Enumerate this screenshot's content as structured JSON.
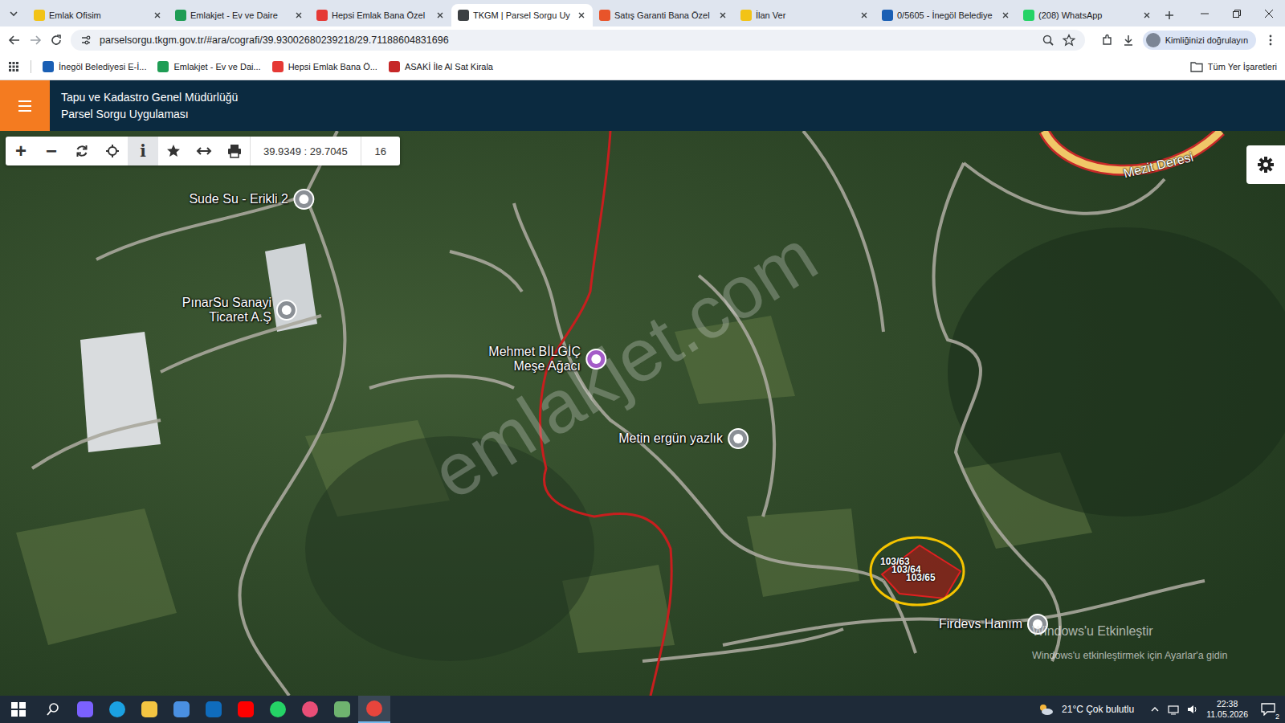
{
  "browser": {
    "tabs": [
      {
        "label": "Emlak Ofisim",
        "selected": false,
        "color": "#f2c316"
      },
      {
        "label": "Emlakjet - Ev ve Daire",
        "selected": false,
        "color": "#1f9d55"
      },
      {
        "label": "Hepsi Emlak Bana Özel",
        "selected": false,
        "color": "#e53935"
      },
      {
        "label": "TKGM | Parsel Sorgu Uy",
        "selected": true,
        "color": "#3c4043"
      },
      {
        "label": "Satış Garanti Bana Özel",
        "selected": false,
        "color": "#e8542a"
      },
      {
        "label": "İlan Ver",
        "selected": false,
        "color": "#f2c316"
      },
      {
        "label": "0/5605 - İnegöl Belediye",
        "selected": false,
        "color": "#1a5fb4"
      },
      {
        "label": "(208) WhatsApp",
        "selected": false,
        "color": "#25d366"
      }
    ],
    "address": {
      "url": "parselsorgu.tkgm.gov.tr/#ara/cografi/39.93002680239218/29.71188604831696",
      "profile": "Kimliğinizi doğrulayın"
    },
    "bookmarks": [
      {
        "label": "İnegöl Belediyesi E-İ...",
        "color": "#1a5fb4"
      },
      {
        "label": "Emlakjet - Ev ve Dai...",
        "color": "#1f9d55"
      },
      {
        "label": "Hepsi Emlak Bana Ö...",
        "color": "#e53935"
      },
      {
        "label": "ASAKİ İle Al Sat Kirala",
        "color": "#c62828"
      }
    ],
    "all_bookmarks": "Tüm Yer İşaretleri"
  },
  "app": {
    "title_lines": [
      "Tapu ve Kadastro Genel Müdürlüğü",
      "Parsel Sorgu Uygulaması"
    ]
  },
  "toolbar": {
    "buttons": [
      {
        "kind": "zoom-in",
        "glyph": "+",
        "selected": false
      },
      {
        "kind": "zoom-out",
        "glyph": "−",
        "selected": false
      },
      {
        "kind": "refresh",
        "glyph": "",
        "selected": false
      },
      {
        "kind": "locate",
        "glyph": "",
        "selected": false
      },
      {
        "kind": "info",
        "glyph": "i",
        "selected": true
      },
      {
        "kind": "favorite",
        "glyph": "",
        "selected": false
      },
      {
        "kind": "measure",
        "glyph": "",
        "selected": false
      },
      {
        "kind": "print",
        "glyph": "",
        "selected": false
      }
    ],
    "coords": "39.9349 : 29.7045",
    "zoom": "16"
  },
  "map": {
    "pins": [
      {
        "lines": [
          "Sude Su - Erikli 2"
        ],
        "color": "#8a8f95"
      },
      {
        "lines": [
          "PınarSu Sanayi",
          "Ticaret A.Ş"
        ],
        "color": "#8a8f95"
      },
      {
        "lines": [
          "Mehmet BİLGİÇ",
          "Meşe Ağacı"
        ],
        "color": "#a45cc8"
      },
      {
        "lines": [
          "Metin ergün yazlık"
        ],
        "color": "#8a8f95"
      },
      {
        "lines": [
          "Firdevs Hanım"
        ],
        "color": "#8a8f95"
      }
    ],
    "river": "Mezit Deresi",
    "parcels": [
      "103/63",
      "103/64",
      "103/65"
    ],
    "watermark": "emlakjet.com",
    "activation": [
      "Windows'u Etkinleştir",
      "Windows'u etkinleştirmek için Ayarlar'a gidin"
    ]
  },
  "taskbar": {
    "apps": [
      {
        "kind": "copilot",
        "color": "#7b61ff",
        "selected": false
      },
      {
        "kind": "edge",
        "color": "#1ba1e2",
        "selected": false
      },
      {
        "kind": "explorer",
        "color": "#f4c542",
        "selected": false
      },
      {
        "kind": "store",
        "color": "#4a90e2",
        "selected": false
      },
      {
        "kind": "outlook",
        "color": "#0f6cbd",
        "selected": false
      },
      {
        "kind": "youtube",
        "color": "#ff0000",
        "selected": false
      },
      {
        "kind": "whatsapp",
        "color": "#25d366",
        "selected": false
      },
      {
        "kind": "drop",
        "color": "#e94e77",
        "selected": false
      },
      {
        "kind": "tool",
        "color": "#6fb36f",
        "selected": false
      },
      {
        "kind": "chrome",
        "color": "#e8453c",
        "selected": true
      }
    ],
    "weather": "21°C Çok bulutlu",
    "time": "22:38",
    "date": "11.05.2026",
    "notifications": "2"
  }
}
